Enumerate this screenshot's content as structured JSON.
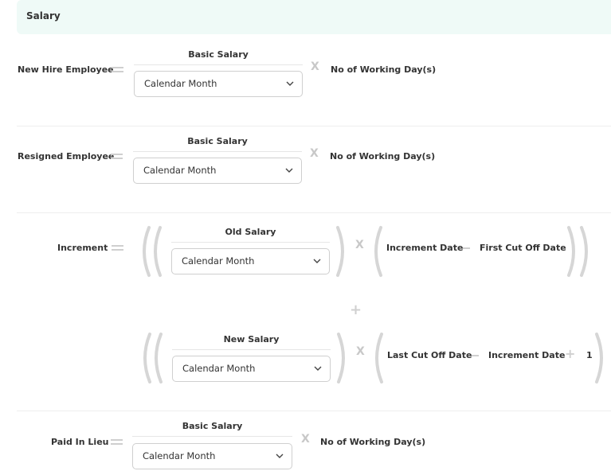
{
  "header": {
    "title": "Salary"
  },
  "rows": {
    "new_hire": {
      "label": "New Hire Employee",
      "block_title": "Basic Salary",
      "select_value": "Calendar Month",
      "result_term": "No of Working Day(s)"
    },
    "resigned": {
      "label": "Resigned Employee",
      "block_title": "Basic Salary",
      "select_value": "Calendar Month",
      "result_term": "No of Working Day(s)"
    },
    "increment": {
      "label": "Increment",
      "part1": {
        "block_title": "Old Salary",
        "select_value": "Calendar Month",
        "term_a": "Increment Date",
        "term_b": "First Cut Off Date"
      },
      "part2": {
        "block_title": "New Salary",
        "select_value": "Calendar Month",
        "term_a": "Last Cut Off Date",
        "term_b": "Increment Date",
        "term_c": "1"
      }
    },
    "paid_in_lieu": {
      "label": "Paid In Lieu",
      "block_title": "Basic Salary",
      "select_value": "Calendar Month",
      "result_term": "No of Working Day(s)"
    }
  },
  "operators": {
    "times": "X",
    "plus": "+"
  },
  "colors": {
    "header_bg": "#effaf7",
    "operator": "#cfcfcf",
    "border": "#cfcfcf"
  },
  "icons": [
    "equals-icon",
    "times-icon",
    "minus-icon",
    "plus-icon",
    "chevron-down-icon"
  ]
}
